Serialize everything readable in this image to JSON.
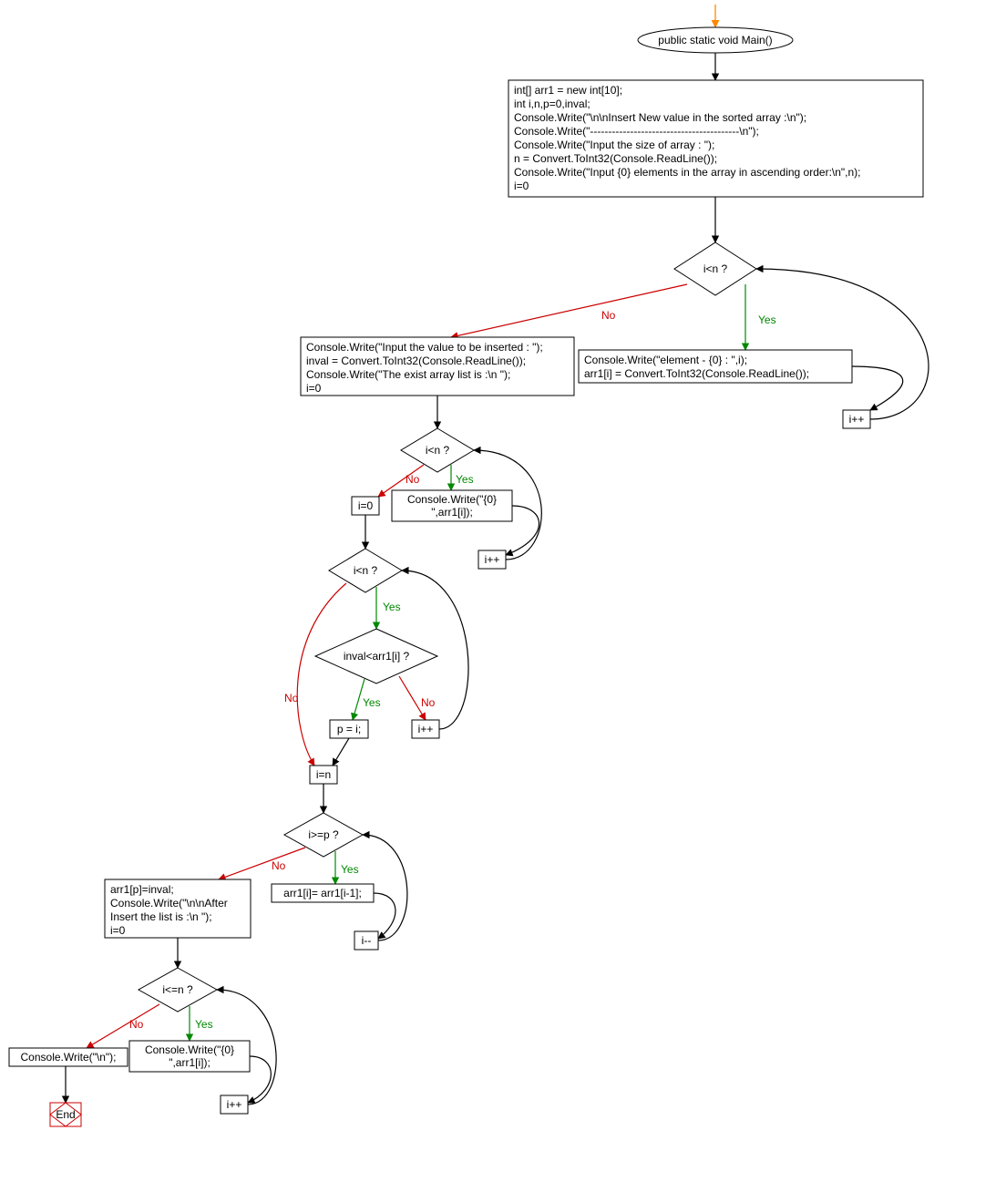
{
  "nodes": {
    "start": {
      "label": "public static void Main()"
    },
    "init": {
      "lines": [
        "int[] arr1 = new int[10];",
        "int i,n,p=0,inval;",
        "Console.Write(\"\\n\\nInsert New value in the sorted array :\\n\");",
        "Console.Write(\"-----------------------------------------\\n\");",
        "Console.Write(\"Input the size of array : \");",
        "n = Convert.ToInt32(Console.ReadLine());",
        "Console.Write(\"Input {0} elements in the array in ascending order:\\n\",n);",
        "i=0"
      ]
    },
    "d1": {
      "label": "i<n ?"
    },
    "readElem": {
      "lines": [
        "Console.Write(\"element - {0} : \",i);",
        "arr1[i] = Convert.ToInt32(Console.ReadLine());"
      ]
    },
    "inc1": {
      "label": "i++"
    },
    "inputInval": {
      "lines": [
        "Console.Write(\"Input the value to be inserted : \");",
        "inval = Convert.ToInt32(Console.ReadLine());",
        "Console.Write(\"The exist array list is :\\n \");",
        "i=0"
      ]
    },
    "d2": {
      "label": "i<n ?"
    },
    "printArr": {
      "lines": [
        "Console.Write(\"{0}",
        "\",arr1[i]);"
      ]
    },
    "inc2": {
      "label": "i++"
    },
    "reset0": {
      "label": "i=0"
    },
    "d3": {
      "label": "i<n ?"
    },
    "d4": {
      "label": "inval<arr1[i] ?"
    },
    "setP": {
      "label": "p = i;"
    },
    "inc3": {
      "label": "i++"
    },
    "setN": {
      "label": "i=n"
    },
    "d5": {
      "label": "i>=p ?"
    },
    "shift": {
      "label": "arr1[i]= arr1[i-1];"
    },
    "dec": {
      "label": "i--"
    },
    "afterIns": {
      "lines": [
        "arr1[p]=inval;",
        "Console.Write(\"\\n\\nAfter",
        "Insert the list is :\\n \");",
        "i=0"
      ]
    },
    "d6": {
      "label": "i<=n ?"
    },
    "print2": {
      "lines": [
        "Console.Write(\"{0}",
        "\",arr1[i]);"
      ]
    },
    "inc4": {
      "label": "i++"
    },
    "writeN": {
      "label": "Console.Write(\"\\n\");"
    },
    "end": {
      "label": "End"
    }
  },
  "labels": {
    "yes": "Yes",
    "no": "No"
  }
}
